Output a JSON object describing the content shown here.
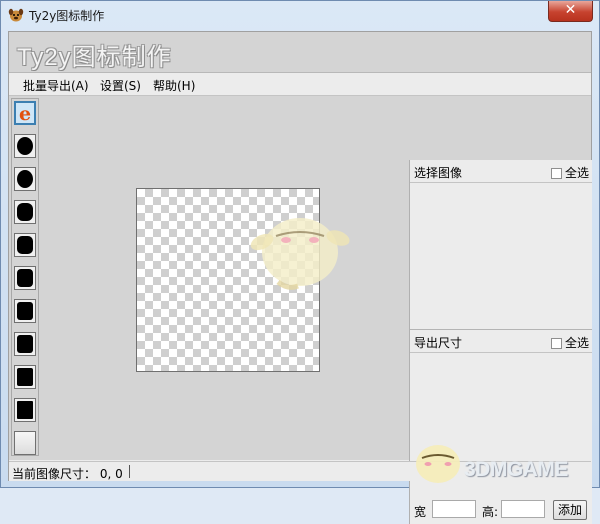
{
  "window": {
    "title": "Ty2y图标制作",
    "close_glyph": "✕"
  },
  "banner": {
    "title": "Ty2y图标制作"
  },
  "menu": [
    {
      "label": "批量导出(A)"
    },
    {
      "label": "设置(S)"
    },
    {
      "label": "帮助(H)"
    }
  ],
  "toolstrip": {
    "items": [
      {
        "icon": "ie-logo-icon",
        "selected": true
      },
      {
        "icon": "circle-shape-icon"
      },
      {
        "icon": "circle-shape-icon"
      },
      {
        "icon": "rounded-square-shape-icon"
      },
      {
        "icon": "rounded-square-shape-icon"
      },
      {
        "icon": "rounded-square-shape-icon"
      },
      {
        "icon": "square-shape-icon"
      },
      {
        "icon": "square-shape-icon"
      },
      {
        "icon": "square-shape-icon"
      },
      {
        "icon": "square-shape-icon"
      },
      {
        "icon": "blank-shape-icon"
      }
    ]
  },
  "right_panel": {
    "select_image": {
      "title": "选择图像",
      "select_all": "全选"
    },
    "export_size": {
      "title": "导出尺寸",
      "select_all": "全选"
    },
    "width_label": "宽",
    "height_label": "高:",
    "width_value": "",
    "height_value": "",
    "add_button": "添加"
  },
  "statusbar": {
    "text": "当前图像尺寸：  0, 0"
  },
  "watermark": {
    "text": "3DMGAME"
  },
  "colors": {
    "accent": "#3c7fb1",
    "close": "#c7432f",
    "ie_orange": "#e3510d"
  }
}
